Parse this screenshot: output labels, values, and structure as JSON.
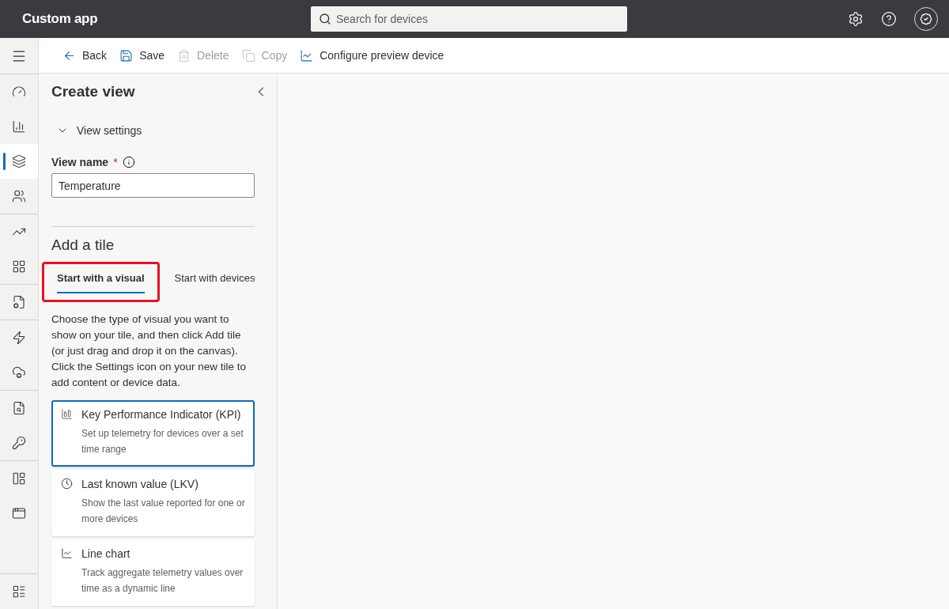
{
  "app": {
    "title": "Custom app"
  },
  "search": {
    "placeholder": "Search for devices"
  },
  "header_icons": [
    {
      "kind": "settings"
    },
    {
      "kind": "help"
    },
    {
      "kind": "account"
    }
  ],
  "rail": {
    "groups": [
      [
        {
          "kind": "dashboard",
          "selected": false
        },
        {
          "kind": "devices",
          "selected": false
        },
        {
          "kind": "views",
          "selected": true
        },
        {
          "kind": "groups",
          "selected": false
        }
      ],
      [
        {
          "kind": "analytics",
          "selected": false
        },
        {
          "kind": "templates",
          "selected": false
        }
      ],
      [
        {
          "kind": "jobs",
          "selected": false
        }
      ],
      [
        {
          "kind": "rules",
          "selected": false
        },
        {
          "kind": "export",
          "selected": false
        }
      ],
      [
        {
          "kind": "audit",
          "selected": false
        },
        {
          "kind": "permissions",
          "selected": false
        }
      ],
      [
        {
          "kind": "customization",
          "selected": false
        },
        {
          "kind": "settings",
          "selected": false
        }
      ],
      [
        {
          "kind": "apps",
          "selected": false
        }
      ]
    ]
  },
  "toolbar": [
    {
      "kind": "back",
      "label": "Back",
      "disabled": false
    },
    {
      "kind": "save",
      "label": "Save",
      "disabled": false
    },
    {
      "kind": "delete",
      "label": "Delete",
      "disabled": true
    },
    {
      "kind": "copy",
      "label": "Copy",
      "disabled": true
    },
    {
      "kind": "preview",
      "label": "Configure preview device",
      "disabled": false
    }
  ],
  "panel": {
    "title": "Create view",
    "section": {
      "label": "View settings",
      "expanded": true
    },
    "field": {
      "label": "View name",
      "required_mark": "*",
      "value": "Temperature"
    },
    "add_title": "Add a tile",
    "tabs": [
      {
        "label": "Start with a visual",
        "selected": true,
        "highlighted": true
      },
      {
        "label": "Start with devices",
        "selected": false,
        "highlighted": false
      }
    ],
    "description": "Choose the type of visual you want to show on your tile, and then click Add tile (or just drag and drop it on the canvas). Click the Settings icon on your new tile to add content or device data.",
    "tiles": [
      {
        "kind": "kpi",
        "title": "Key Performance Indicator (KPI)",
        "description": "Set up telemetry for devices over a set time range",
        "selected": true
      },
      {
        "kind": "lkv",
        "title": "Last known value (LKV)",
        "description": "Show the last value reported for one or more devices",
        "selected": false
      },
      {
        "kind": "line",
        "title": "Line chart",
        "description": "Track aggregate telemetry values over time as a dynamic line",
        "selected": false
      }
    ]
  }
}
